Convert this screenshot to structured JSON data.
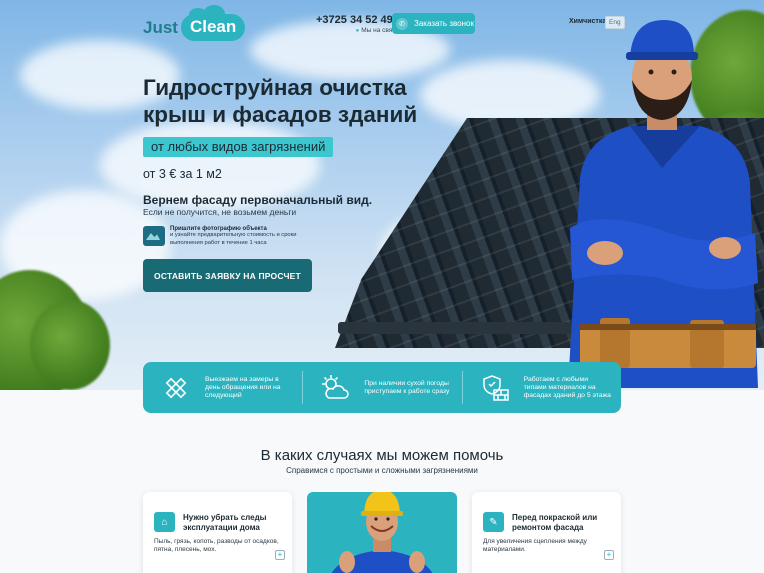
{
  "header": {
    "logo_just": "Just",
    "logo_clean": "Clean",
    "phone": "+3725 34 52 492",
    "phone_status": "Мы на связи",
    "callback_label": "Заказать звонок",
    "nav_link": "Химчистка",
    "lang": "Eng"
  },
  "hero": {
    "title": "Гидроструйная очистка крыш и фасадов зданий",
    "pill": "от любых видов загрязнений",
    "price": "от 3 € за 1 м2",
    "slogan": "Вернем фасаду первоначальный вид.",
    "slogan_sub": "Если не получится, не возьмем деньги",
    "photo_title": "Пришлите фотографию объекта",
    "photo_text": "и узнайте предварительную стоимость и сроки выполнения работ в течение 1 часа",
    "cta": "ОСТАВИТЬ ЗАЯВКУ НА ПРОСЧЕТ"
  },
  "features": [
    {
      "icon": "ruler-pencil-icon",
      "text": "Выезжаем на замеры в день обращения или на следующий"
    },
    {
      "icon": "sun-cloud-icon",
      "text": "При наличии сухой погоды приступаем к работе сразу"
    },
    {
      "icon": "shield-bricks-icon",
      "text": "Работаем с любыми типами материалов на фасадах зданий до 5 этажа"
    }
  ],
  "section": {
    "title": "В каких случаях мы можем помочь",
    "subtitle": "Справимся с простыми и сложными загрязнениями"
  },
  "cards": [
    {
      "title": "Нужно убрать следы эксплуатации дома",
      "text": "Пыль, грязь, копоть, разводы от осадков, пятна, плесень, мох.",
      "plus": "+"
    },
    {
      "title": "Перед покраской или ремонтом фасада",
      "text": "Для увеличения сцепления между материалами.",
      "plus": "+"
    }
  ],
  "colors": {
    "accent": "#2bb3c0",
    "cta": "#186a74",
    "text": "#1c2a33"
  }
}
